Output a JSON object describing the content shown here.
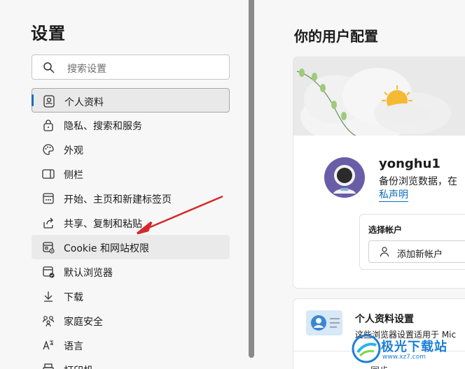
{
  "sidebar": {
    "title": "设置",
    "search_placeholder": "搜索设置",
    "items": [
      {
        "label": "个人资料",
        "icon": "profile-icon"
      },
      {
        "label": "隐私、搜索和服务",
        "icon": "lock-icon"
      },
      {
        "label": "外观",
        "icon": "palette-icon"
      },
      {
        "label": "侧栏",
        "icon": "sidebar-icon"
      },
      {
        "label": "开始、主页和新建标签页",
        "icon": "home-tabs-icon"
      },
      {
        "label": "共享、复制和粘贴",
        "icon": "share-icon"
      },
      {
        "label": "Cookie 和网站权限",
        "icon": "cookie-permissions-icon"
      },
      {
        "label": "默认浏览器",
        "icon": "default-browser-icon"
      },
      {
        "label": "下载",
        "icon": "download-icon"
      },
      {
        "label": "家庭安全",
        "icon": "family-icon"
      },
      {
        "label": "语言",
        "icon": "language-icon"
      },
      {
        "label": "打印机",
        "icon": "printer-icon"
      }
    ]
  },
  "main": {
    "page_title": "你的用户配置",
    "profile": {
      "username": "yonghu1",
      "sync_text": "备份浏览数据，在",
      "privacy_link": "私声明",
      "account_label": "选择帐户",
      "add_account": "添加新帐户"
    },
    "settings_card": {
      "title": "个人资料设置",
      "desc": "这些浏览器设置适用于 Mic",
      "sub_item": "同步"
    }
  },
  "watermark": {
    "text": "极光下载站",
    "url": "www.xz7.com"
  },
  "colors": {
    "accent": "#0f6cbd",
    "annotation_arrow": "#d42a2a",
    "background": "#f7f7f7"
  }
}
